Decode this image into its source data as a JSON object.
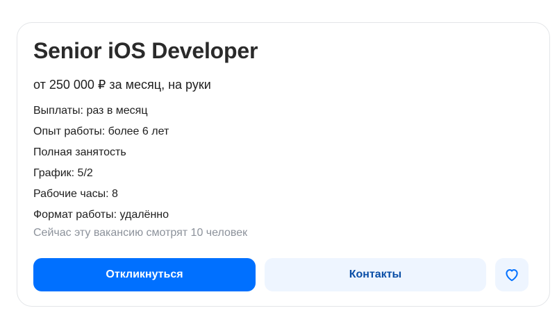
{
  "vacancy": {
    "title": "Senior iOS Developer",
    "salary": "от 250 000 ₽ за месяц, на руки",
    "facts": [
      "Выплаты: раз в месяц",
      "Опыт работы: более 6 лет",
      "Полная занятость",
      "График: 5/2",
      "Рабочие часы: 8",
      "Формат работы: удалённо"
    ],
    "viewers": "Сейчас эту вакансию смотрят 10 человек"
  },
  "actions": {
    "respond_label": "Откликнуться",
    "contacts_label": "Контакты",
    "favorite_icon": "heart-icon"
  },
  "colors": {
    "primary": "#0070ff",
    "secondary_bg": "#eef5ff",
    "secondary_text": "#0a4ea6",
    "muted_text": "#8c929b"
  }
}
